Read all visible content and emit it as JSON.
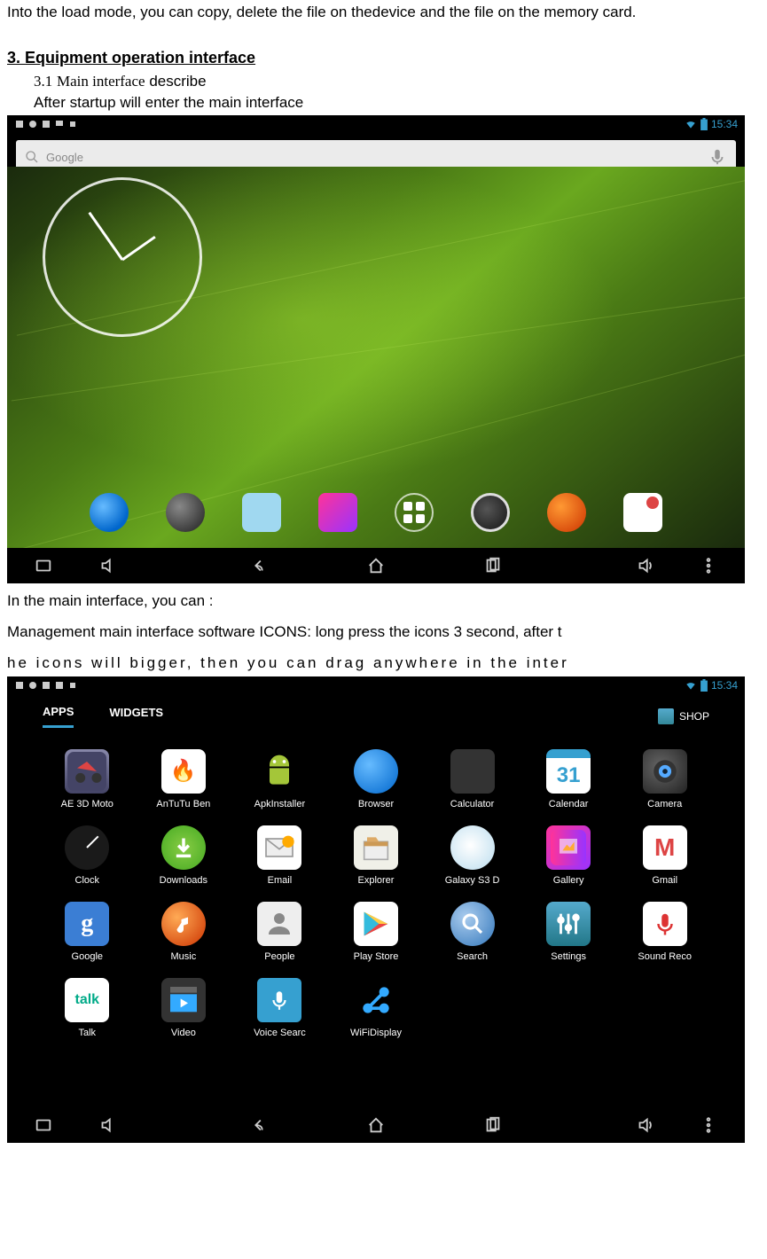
{
  "intro": "Into the load mode, you can copy, delete the file on thedevice and the file on the memory card.",
  "section": {
    "number": "3.",
    "title": "Equipment operation interface",
    "sub_number": "3.1",
    "sub_title": "Main interface",
    "sub_word": "describe",
    "desc": "After startup will enter the main interface"
  },
  "status": {
    "time": "15:34"
  },
  "search": {
    "brand": "Google",
    "placeholder": ""
  },
  "caption": {
    "line1": "In the main interface, you can :",
    "line2": "Management main interface software ICONS: long press the icons 3 second, after t",
    "line3": "he icons will bigger, then you can drag anywhere in the inter"
  },
  "drawer": {
    "tab_apps": "APPS",
    "tab_widgets": "WIDGETS",
    "shop": "SHOP",
    "apps": [
      {
        "label": "AE 3D Moto",
        "cls": "ico-moto"
      },
      {
        "label": "AnTuTu Ben",
        "cls": "ico-antutu"
      },
      {
        "label": "ApkInstaller",
        "cls": "ico-apkinstaller"
      },
      {
        "label": "Browser",
        "cls": "ico-browser"
      },
      {
        "label": "Calculator",
        "cls": "ico-calc"
      },
      {
        "label": "Calendar",
        "cls": "ico-calendar"
      },
      {
        "label": "Camera",
        "cls": "ico-camera"
      },
      {
        "label": "Clock",
        "cls": "ico-clock"
      },
      {
        "label": "Downloads",
        "cls": "ico-downloads"
      },
      {
        "label": "Email",
        "cls": "ico-email"
      },
      {
        "label": "Explorer",
        "cls": "ico-explorer"
      },
      {
        "label": "Galaxy S3 D",
        "cls": "ico-galaxy"
      },
      {
        "label": "Gallery",
        "cls": "ico-gallery"
      },
      {
        "label": "Gmail",
        "cls": "ico-gmail"
      },
      {
        "label": "Google",
        "cls": "ico-google"
      },
      {
        "label": "Music",
        "cls": "ico-music"
      },
      {
        "label": "People",
        "cls": "ico-people"
      },
      {
        "label": "Play Store",
        "cls": "ico-play"
      },
      {
        "label": "Search",
        "cls": "ico-search"
      },
      {
        "label": "Settings",
        "cls": "ico-settings"
      },
      {
        "label": "Sound Reco",
        "cls": "ico-soundrec"
      },
      {
        "label": "Talk",
        "cls": "ico-talk"
      },
      {
        "label": "Video",
        "cls": "ico-video"
      },
      {
        "label": "Voice Searc",
        "cls": "ico-voice"
      },
      {
        "label": "WiFiDisplay",
        "cls": "ico-wifi"
      }
    ]
  },
  "calendar_day": "31"
}
